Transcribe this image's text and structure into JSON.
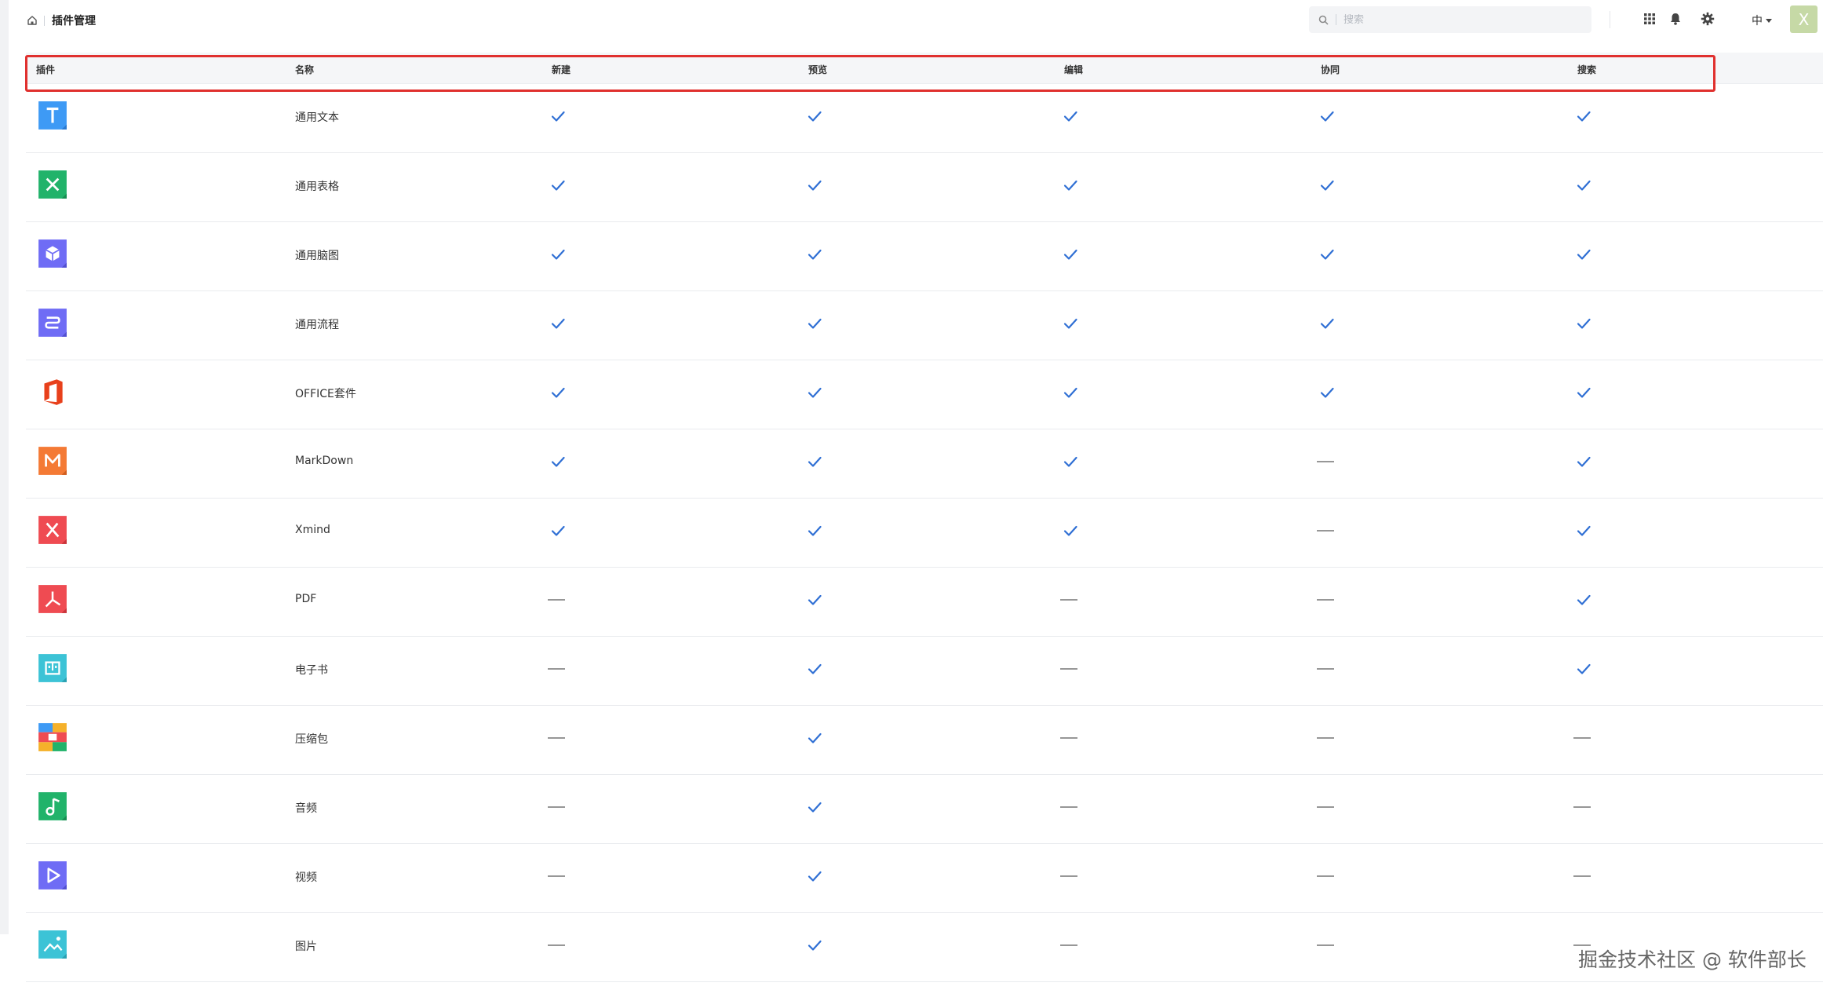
{
  "header": {
    "breadcrumb_title": "插件管理",
    "search_placeholder": "搜索",
    "language": "中",
    "avatar_letter": "X"
  },
  "table": {
    "columns": [
      "插件",
      "名称",
      "新建",
      "预览",
      "编辑",
      "协同",
      "搜索"
    ],
    "rows": [
      {
        "name": "通用文本",
        "icon": "text-plugin-icon",
        "support": [
          true,
          true,
          true,
          true,
          true
        ]
      },
      {
        "name": "通用表格",
        "icon": "spreadsheet-plugin-icon",
        "support": [
          true,
          true,
          true,
          true,
          true
        ]
      },
      {
        "name": "通用脑图",
        "icon": "mindmap-plugin-icon",
        "support": [
          true,
          true,
          true,
          true,
          true
        ]
      },
      {
        "name": "通用流程",
        "icon": "flowchart-plugin-icon",
        "support": [
          true,
          true,
          true,
          true,
          true
        ]
      },
      {
        "name": "OFFICE套件",
        "icon": "office-plugin-icon",
        "support": [
          true,
          true,
          true,
          true,
          true
        ]
      },
      {
        "name": "MarkDown",
        "icon": "markdown-plugin-icon",
        "support": [
          true,
          true,
          true,
          false,
          true
        ]
      },
      {
        "name": "Xmind",
        "icon": "xmind-plugin-icon",
        "support": [
          true,
          true,
          true,
          false,
          true
        ]
      },
      {
        "name": "PDF",
        "icon": "pdf-plugin-icon",
        "support": [
          false,
          true,
          false,
          false,
          true
        ]
      },
      {
        "name": "电子书",
        "icon": "ebook-plugin-icon",
        "support": [
          false,
          true,
          false,
          false,
          true
        ]
      },
      {
        "name": "压缩包",
        "icon": "archive-plugin-icon",
        "support": [
          false,
          true,
          false,
          false,
          false
        ]
      },
      {
        "name": "音频",
        "icon": "audio-plugin-icon",
        "support": [
          false,
          true,
          false,
          false,
          false
        ]
      },
      {
        "name": "视频",
        "icon": "video-plugin-icon",
        "support": [
          false,
          true,
          false,
          false,
          false
        ]
      },
      {
        "name": "图片",
        "icon": "image-plugin-icon",
        "support": [
          false,
          true,
          false,
          false,
          false
        ]
      }
    ]
  },
  "colors": {
    "check": "#2f6fd4",
    "dash": "#888888",
    "highlight": "#e0302e"
  },
  "watermark": "掘金技术社区 @ 软件部长"
}
